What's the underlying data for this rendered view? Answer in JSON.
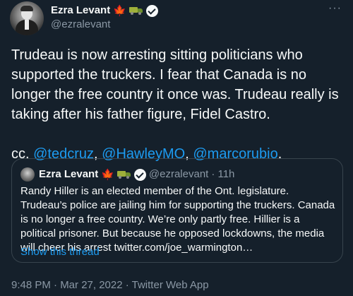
{
  "tweet": {
    "author": {
      "name": "Ezra Levant",
      "handle": "@ezralevant",
      "badges": [
        "maple-leaf-icon",
        "truck-icon",
        "verified-icon"
      ]
    },
    "more_icon": "···",
    "body_lines": [
      "Trudeau is now arresting sitting politicians who supported the truckers. I fear that Canada is no longer the free country it once was. Trudeau really is taking after his father figure, Fidel Castro."
    ],
    "cc_prefix": "cc.",
    "mentions": [
      "@tedcruz",
      "@HawleyMO",
      "@marcorubio"
    ],
    "mention_separator": ",",
    "cc_end": ".",
    "footer": "9:48 PM · Mar 27, 2022 · Twitter Web App"
  },
  "quoted": {
    "author": {
      "name": "Ezra Levant",
      "handle": "@ezralevant",
      "time": "· 11h"
    },
    "text": "Randy Hiller is an elected member of the Ont. legislature. Trudeau’s police are jailing him for supporting the truckers. Canada is no longer a free country. We’re only partly free. Hillier is a political prisoner. But because he opposed lockdowns, the media will cheer his arrest twitter.com/joe_warmington…",
    "show_thread": "Show this thread"
  },
  "colors": {
    "background": "#15202b",
    "text": "#f7f9f9",
    "secondary": "#8b98a5",
    "link": "#1d9bf0",
    "border": "#38444d"
  }
}
